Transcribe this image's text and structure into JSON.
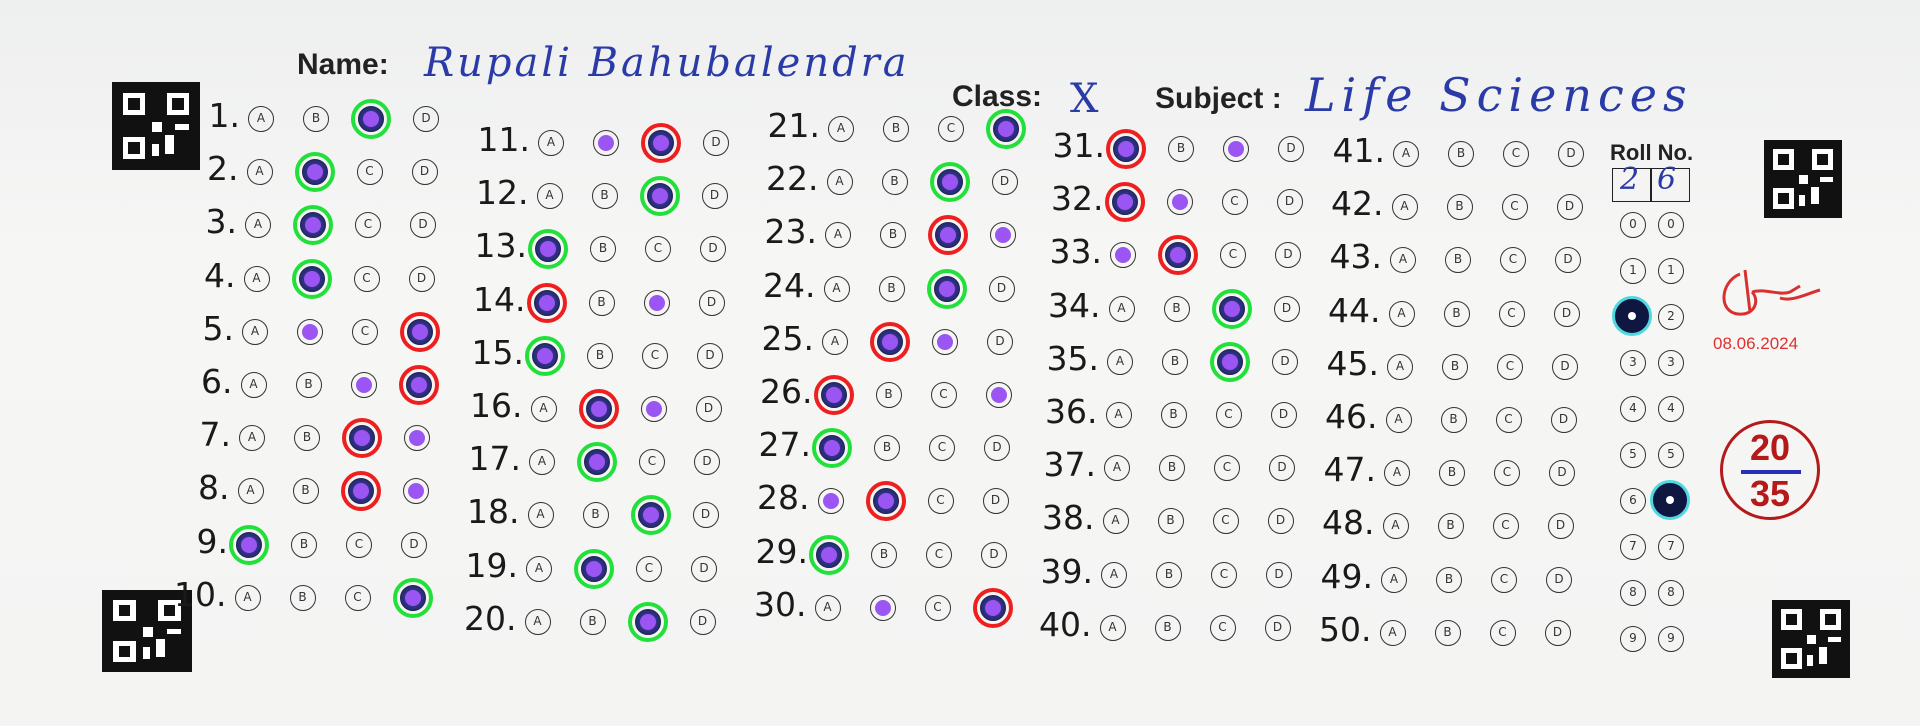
{
  "header": {
    "name_label": "Name:",
    "name_value": "Rupali Bahubalendra",
    "class_label": "Class:",
    "class_value": "X",
    "subject_label": "Subject :",
    "subject_value": "Life Sciences"
  },
  "option_letters": [
    "A",
    "B",
    "C",
    "D"
  ],
  "columns": [
    {
      "start": 1,
      "numbers": [
        "1.",
        "2.",
        "3.",
        "4.",
        "5.",
        "6.",
        "7.",
        "8.",
        "9.",
        "10."
      ]
    },
    {
      "start": 11,
      "numbers": [
        "11.",
        "12.",
        "13.",
        "14.",
        "15.",
        "16.",
        "17.",
        "18.",
        "19.",
        "20."
      ]
    },
    {
      "start": 21,
      "numbers": [
        "21.",
        "22.",
        "23.",
        "24.",
        "25.",
        "26.",
        "27.",
        "28.",
        "29.",
        "30."
      ]
    },
    {
      "start": 31,
      "numbers": [
        "31.",
        "32.",
        "33.",
        "34.",
        "35.",
        "36.",
        "37.",
        "38.",
        "39.",
        "40."
      ]
    },
    {
      "start": 41,
      "numbers": [
        "41.",
        "42.",
        "43.",
        "44.",
        "45.",
        "46.",
        "47.",
        "48.",
        "49.",
        "50."
      ]
    }
  ],
  "answers": {
    "1": {
      "marked": "C",
      "result": "correct"
    },
    "2": {
      "marked": "B",
      "result": "correct"
    },
    "3": {
      "marked": "B",
      "result": "correct"
    },
    "4": {
      "marked": "B",
      "result": "correct"
    },
    "5": {
      "marked": "D",
      "result": "wrong",
      "key": "B"
    },
    "6": {
      "marked": "D",
      "result": "wrong",
      "key": "C"
    },
    "7": {
      "marked": "C",
      "result": "wrong",
      "key": "D"
    },
    "8": {
      "marked": "C",
      "result": "wrong",
      "key": "D"
    },
    "9": {
      "marked": "A",
      "result": "correct"
    },
    "10": {
      "marked": "D",
      "result": "correct"
    },
    "11": {
      "marked": "C",
      "result": "wrong",
      "key": "B"
    },
    "12": {
      "marked": "C",
      "result": "correct"
    },
    "13": {
      "marked": "A",
      "result": "correct"
    },
    "14": {
      "marked": "A",
      "result": "wrong",
      "key": "C"
    },
    "15": {
      "marked": "A",
      "result": "correct"
    },
    "16": {
      "marked": "B",
      "result": "wrong",
      "key": "C"
    },
    "17": {
      "marked": "B",
      "result": "correct"
    },
    "18": {
      "marked": "C",
      "result": "correct"
    },
    "19": {
      "marked": "B",
      "result": "correct"
    },
    "20": {
      "marked": "C",
      "result": "correct"
    },
    "21": {
      "marked": "D",
      "result": "correct"
    },
    "22": {
      "marked": "C",
      "result": "correct"
    },
    "23": {
      "marked": "C",
      "result": "wrong",
      "key": "D"
    },
    "24": {
      "marked": "C",
      "result": "correct"
    },
    "25": {
      "marked": "B",
      "result": "wrong",
      "key": "C"
    },
    "26": {
      "marked": "A",
      "result": "wrong",
      "key": "D"
    },
    "27": {
      "marked": "A",
      "result": "correct"
    },
    "28": {
      "marked": "B",
      "result": "wrong",
      "key": "A"
    },
    "29": {
      "marked": "A",
      "result": "correct"
    },
    "30": {
      "marked": "D",
      "result": "wrong",
      "key": "B"
    },
    "31": {
      "marked": "A",
      "result": "wrong",
      "key": "C"
    },
    "32": {
      "marked": "A",
      "result": "wrong",
      "key": "B"
    },
    "33": {
      "marked": "B",
      "result": "wrong",
      "key": "A"
    },
    "34": {
      "marked": "C",
      "result": "correct"
    },
    "35": {
      "marked": "C",
      "result": "correct"
    }
  },
  "roll_number": {
    "label": "Roll No.",
    "digits_written": [
      "2",
      "6"
    ],
    "digit_options": [
      "0",
      "1",
      "2",
      "3",
      "4",
      "5",
      "6",
      "7",
      "8",
      "9"
    ],
    "selected": [
      2,
      6
    ]
  },
  "signature": {
    "date": "08.06.2024"
  },
  "score": {
    "obtained": "20",
    "total": "35"
  },
  "colors": {
    "correct_ring": "#22e03a",
    "wrong_ring": "#ee1f1f",
    "key_dot": "#9b55f2",
    "ink": "#2a3ba8",
    "score": "#b51a1a"
  }
}
